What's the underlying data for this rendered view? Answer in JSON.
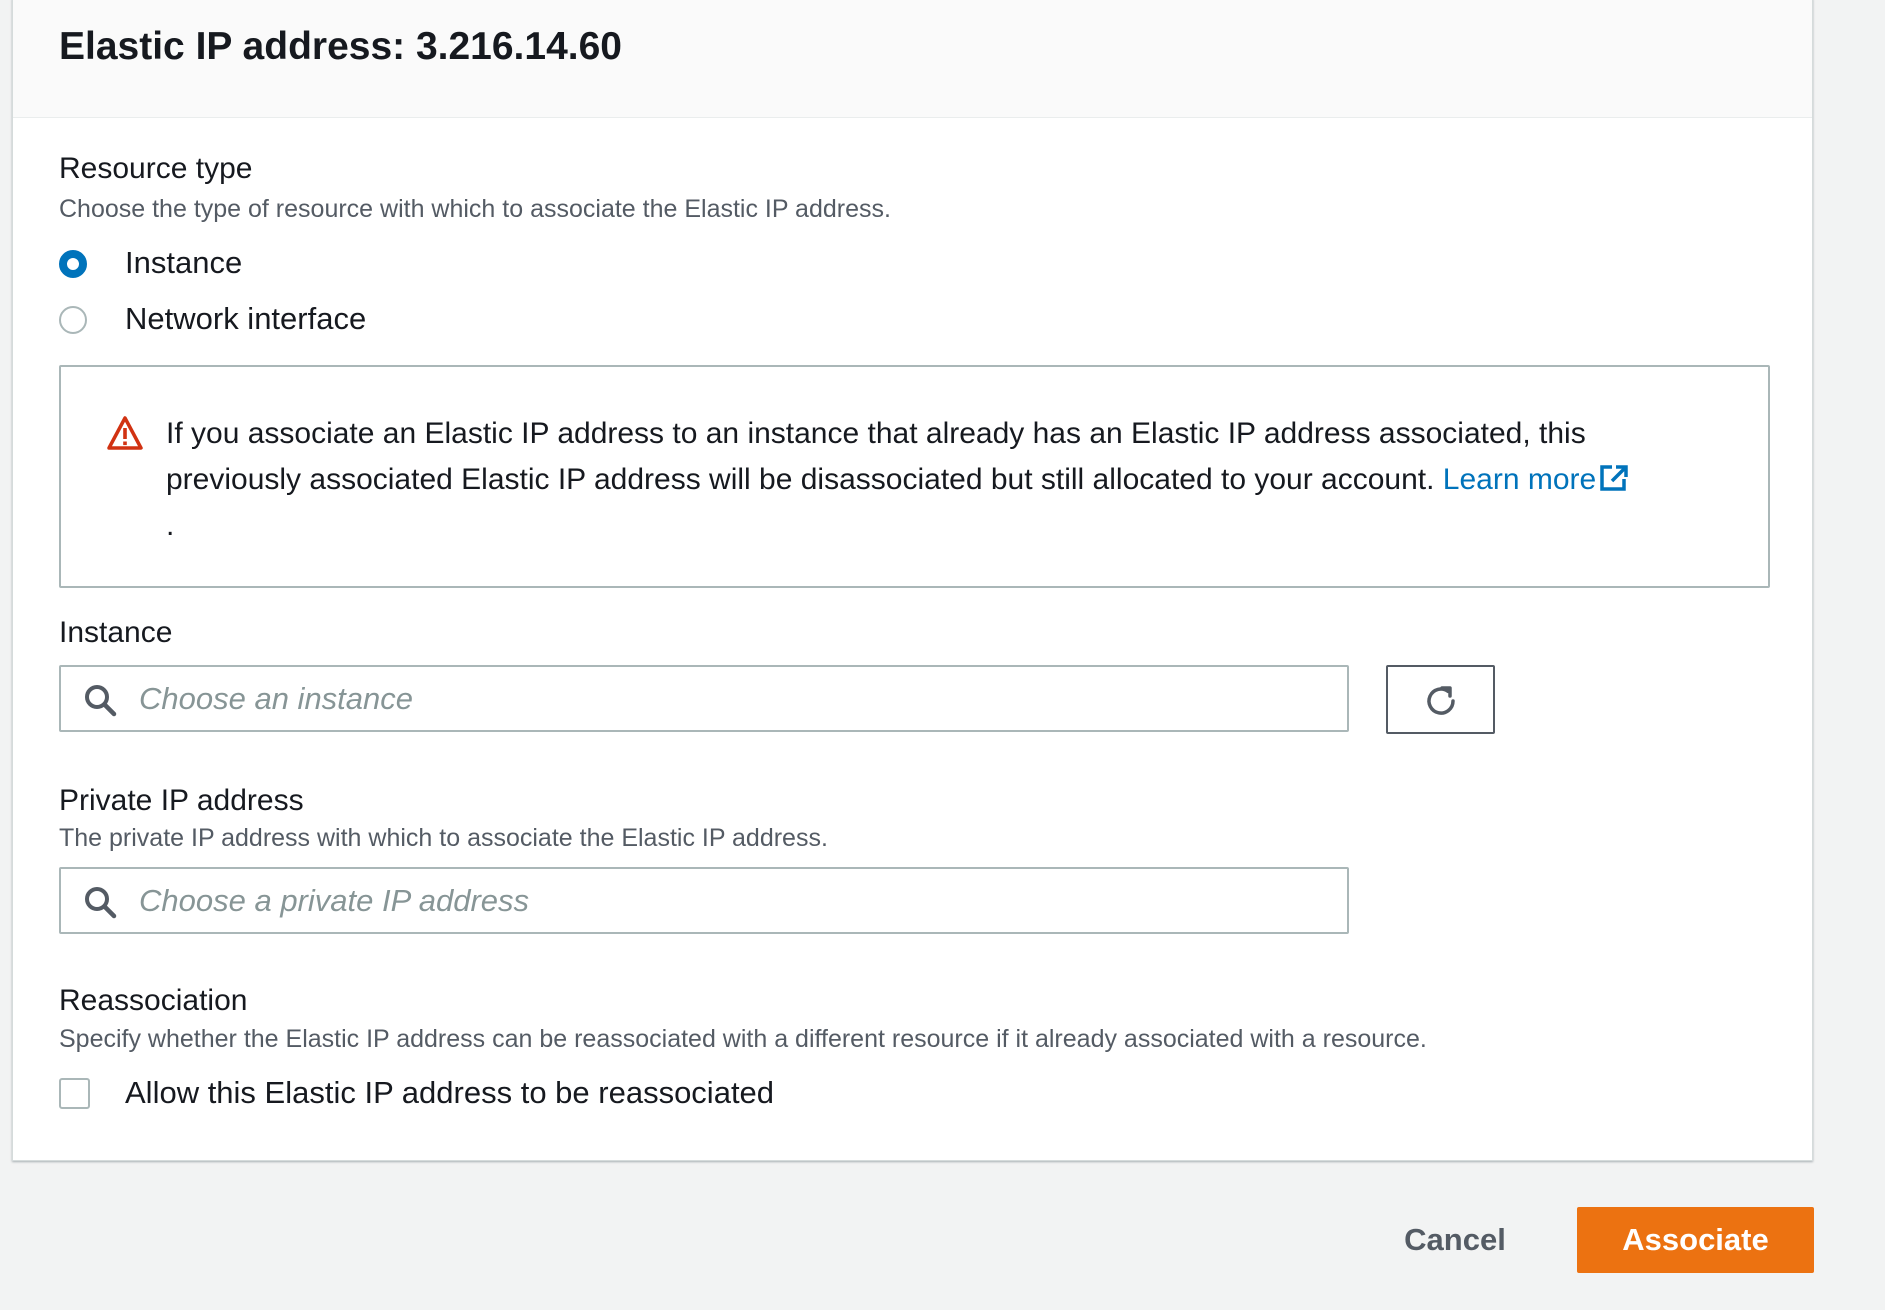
{
  "header": {
    "title": "Elastic IP address: 3.216.14.60"
  },
  "resource_type": {
    "label": "Resource type",
    "description": "Choose the type of resource with which to associate the Elastic IP address.",
    "options": [
      {
        "label": "Instance",
        "selected": true
      },
      {
        "label": "Network interface",
        "selected": false
      }
    ]
  },
  "alert": {
    "icon": "warning-icon",
    "text": "If you associate an Elastic IP address to an instance that already has an Elastic IP address associated, this previously associated Elastic IP address will be disassociated but still allocated to your account.",
    "link_text": "Learn more",
    "link_icon": "external-link-icon",
    "trailing": ".",
    "icon_color": "#d13212"
  },
  "instance": {
    "label": "Instance",
    "placeholder": "Choose an instance",
    "refresh_icon": "refresh-icon"
  },
  "private_ip": {
    "label": "Private IP address",
    "description": "The private IP address with which to associate the Elastic IP address.",
    "placeholder": "Choose a private IP address"
  },
  "reassociation": {
    "label": "Reassociation",
    "description": "Specify whether the Elastic IP address can be reassociated with a different resource if it already associated with a resource.",
    "checkbox_label": "Allow this Elastic IP address to be reassociated",
    "checked": false
  },
  "footer": {
    "cancel_label": "Cancel",
    "associate_label": "Associate"
  },
  "colors": {
    "primary": "#ec7211",
    "link": "#0073bb",
    "warning": "#d13212"
  }
}
